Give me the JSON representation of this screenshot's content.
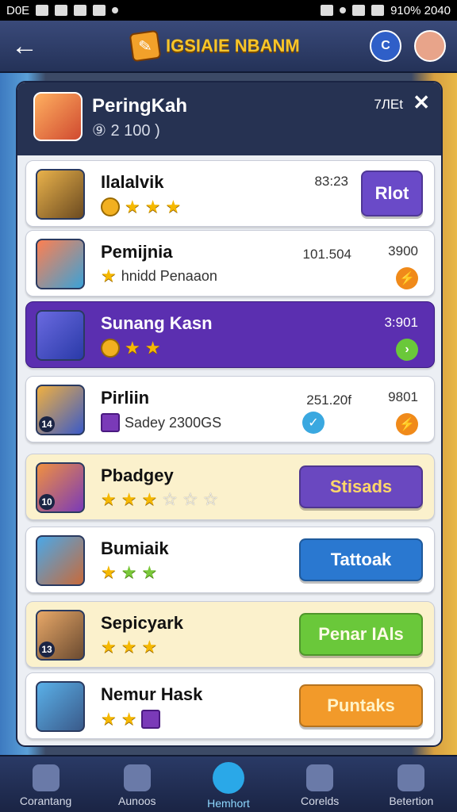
{
  "status_bar": {
    "left": "D0E",
    "right": "910% 2040"
  },
  "header": {
    "back": "←",
    "title": "IGSIAIE NBANM",
    "title_icon": "pencil-box-icon",
    "right_badge": "C"
  },
  "panel": {
    "title": "PeringKah",
    "subtitle": "⑨ 2 100 )",
    "right_text": "7ЛЕt",
    "close": "✕"
  },
  "rows": [
    {
      "name": "Ilalalvik",
      "value": "83:23",
      "button": "Rlot",
      "stars": 3
    },
    {
      "name": "Pemijnia",
      "sub": "hnidd Penaaon",
      "value": "101.504",
      "value2": "3900",
      "stars": 1
    },
    {
      "name": "Sunang Kasn",
      "value2": "3:901",
      "stars": 2
    },
    {
      "name": "Pirliin",
      "sub": "Sadey 2300GS",
      "value": "251.20f",
      "value2": "9801",
      "avatar_num": "14"
    },
    {
      "name": "Pbadgey",
      "button": "Stisads",
      "stars": 6,
      "avatar_num": "10"
    },
    {
      "name": "Bumiaik",
      "button": "Tattoak",
      "stars": 3
    },
    {
      "name": "Sepicyark",
      "button": "Penar IAls",
      "stars": 3,
      "avatar_num": "13"
    },
    {
      "name": "Nemur Hask",
      "button": "Puntaks",
      "stars": 2
    }
  ],
  "bottom_nav": [
    {
      "label": "Corantang",
      "icon": "home-icon"
    },
    {
      "label": "Aunoos",
      "icon": "refresh-icon"
    },
    {
      "label": "Hemhort",
      "icon": "shop-icon"
    },
    {
      "label": "Corelds",
      "icon": "camera-icon"
    },
    {
      "label": "Betertion",
      "icon": "menu-icon"
    }
  ]
}
